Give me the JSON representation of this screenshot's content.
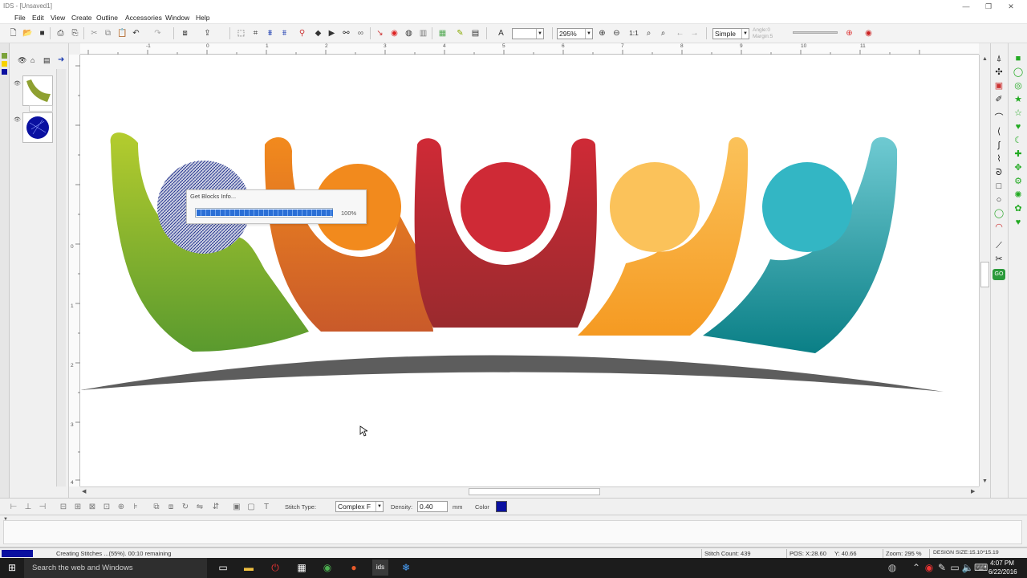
{
  "window": {
    "title": "IDS - [Unsaved1]",
    "controls": [
      "—",
      "❐",
      "✕"
    ]
  },
  "menu": [
    "File",
    "Edit",
    "View",
    "Create",
    "Outline",
    "Accessories",
    "Window",
    "Help"
  ],
  "toolbar": {
    "zoom_value": "295%",
    "zoom_fit_label": "1:1",
    "mode_value": "Simple",
    "angle_label": "Angle:0",
    "margin_label": "Margin:5"
  },
  "ruler": {
    "top_ticks": [
      "-1",
      "0",
      "1",
      "2",
      "3",
      "4",
      "5",
      "6",
      "7",
      "8",
      "9",
      "10",
      "11"
    ],
    "left_ticks": [
      "0",
      "1",
      "2",
      "3",
      "4"
    ]
  },
  "dialog": {
    "title": "Get Blocks Info...",
    "percent": "100%",
    "progress": 1.0
  },
  "propbar": {
    "stitch_type_label": "Stitch Type:",
    "stitch_type_value": "Complex F",
    "density_label": "Density:",
    "density_value": "0.40",
    "unit_label": "mm",
    "color_label": "Color",
    "color_value": "#0a10a0"
  },
  "status": {
    "task_text": "Creating Stitches ...(55%).  00:10 remaining",
    "task_progress": 0.55,
    "stitch_count": "Stitch Count: 439",
    "pos": "POS: X:28.60",
    "pos_y": "Y: 40.66",
    "zoom": "Zoom: 295 %",
    "design_size": "DESIGN SIZE:15.10*15.19"
  },
  "taskbar": {
    "search_placeholder": "Search the web and Windows",
    "time": "4:07 PM",
    "date": "6/22/2016"
  },
  "colors": {
    "accent_blue": "#0a10a0",
    "progress_blue": "#2a6fd6"
  }
}
